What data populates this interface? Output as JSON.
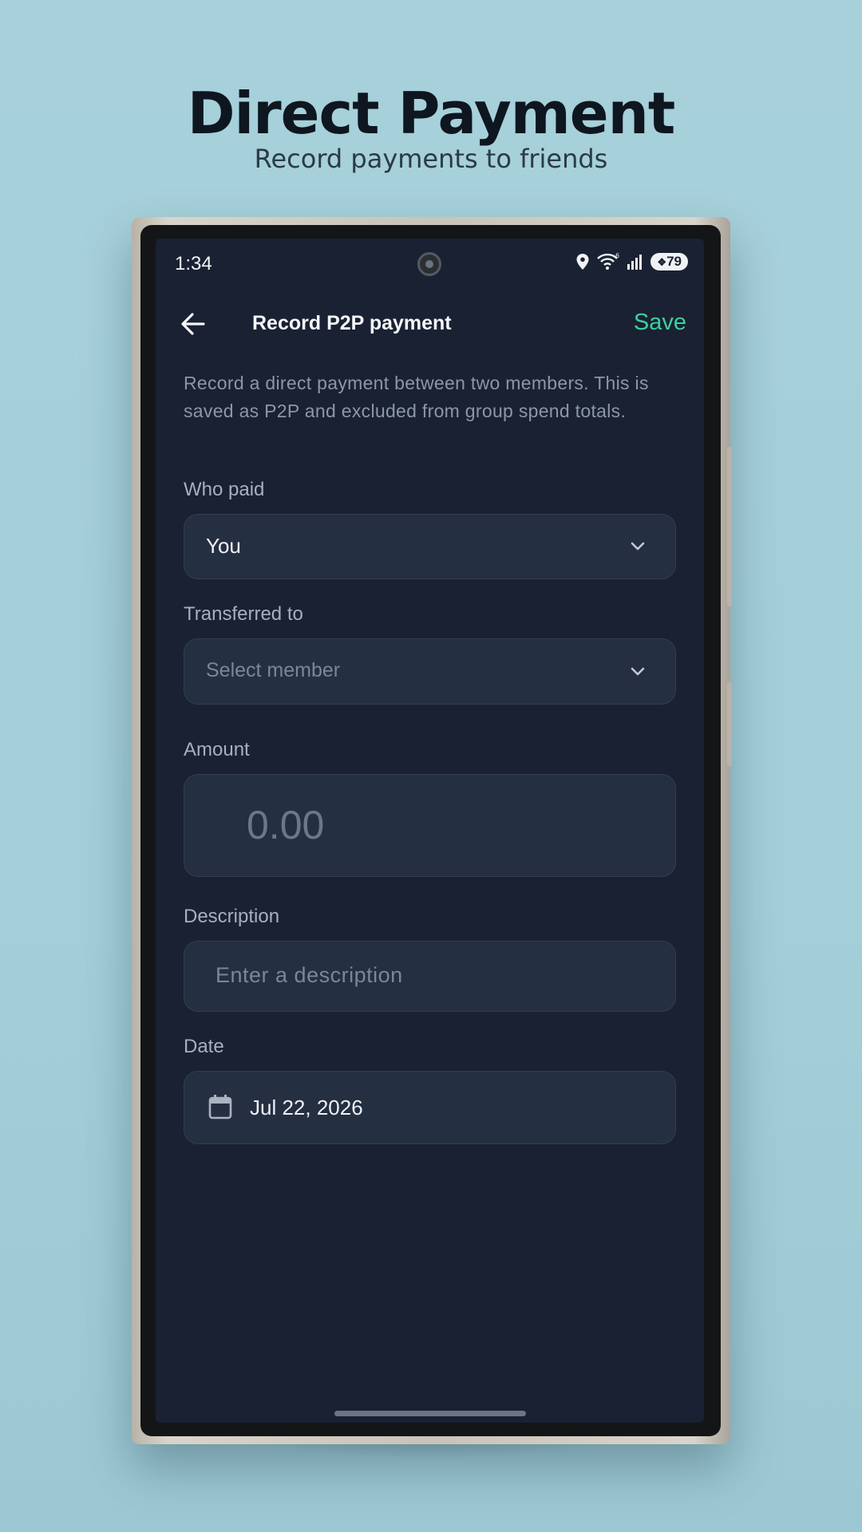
{
  "promo": {
    "title": "Direct Payment",
    "subtitle": "Record payments to friends"
  },
  "status_bar": {
    "time": "1:34",
    "battery": "79",
    "icons": [
      "location-icon",
      "wifi-icon",
      "signal-icon",
      "battery-icon"
    ]
  },
  "appbar": {
    "title": "Record P2P payment",
    "save_label": "Save",
    "back_icon": "arrow-left-icon"
  },
  "description": "Record a direct payment between two members. This is saved as P2P and excluded from group spend totals.",
  "form": {
    "who_paid": {
      "label": "Who paid",
      "value": "You"
    },
    "transferred_to": {
      "label": "Transferred to",
      "placeholder": "Select member"
    },
    "amount": {
      "label": "Amount",
      "placeholder": "0.00"
    },
    "description": {
      "label": "Description",
      "placeholder": "Enter a description"
    },
    "date": {
      "label": "Date",
      "value": "Jul 22, 2026"
    }
  },
  "colors": {
    "accent": "#3ecf9c",
    "screen_bg": "#1a2133",
    "field_bg": "#252f42",
    "page_bg": "#a7d0da"
  }
}
